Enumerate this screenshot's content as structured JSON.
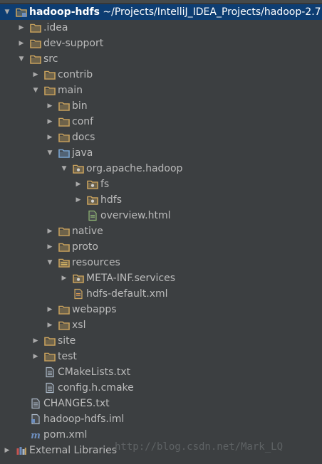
{
  "project_tree": {
    "root": {
      "name": "hadoop-hdfs",
      "path": "~/Projects/IntelliJ_IDEA_Projects/hadoop-2.7"
    },
    "items": [
      {
        "label": "hadoop-hdfs",
        "depth": 0,
        "arrow": "expanded",
        "icon": "module-folder-icon",
        "selected": true
      },
      {
        "label": ".idea",
        "depth": 1,
        "arrow": "collapsed",
        "icon": "folder-icon"
      },
      {
        "label": "dev-support",
        "depth": 1,
        "arrow": "collapsed",
        "icon": "folder-icon"
      },
      {
        "label": "src",
        "depth": 1,
        "arrow": "expanded",
        "icon": "folder-icon"
      },
      {
        "label": "contrib",
        "depth": 2,
        "arrow": "collapsed",
        "icon": "folder-icon"
      },
      {
        "label": "main",
        "depth": 2,
        "arrow": "expanded",
        "icon": "folder-icon"
      },
      {
        "label": "bin",
        "depth": 3,
        "arrow": "collapsed",
        "icon": "folder-icon"
      },
      {
        "label": "conf",
        "depth": 3,
        "arrow": "collapsed",
        "icon": "folder-icon"
      },
      {
        "label": "docs",
        "depth": 3,
        "arrow": "collapsed",
        "icon": "folder-icon"
      },
      {
        "label": "java",
        "depth": 3,
        "arrow": "expanded",
        "icon": "source-root-folder-icon"
      },
      {
        "label": "org.apache.hadoop",
        "depth": 4,
        "arrow": "expanded",
        "icon": "package-icon"
      },
      {
        "label": "fs",
        "depth": 5,
        "arrow": "collapsed",
        "icon": "package-icon"
      },
      {
        "label": "hdfs",
        "depth": 5,
        "arrow": "collapsed",
        "icon": "package-icon"
      },
      {
        "label": "overview.html",
        "depth": 5,
        "arrow": "none",
        "icon": "html-file-icon"
      },
      {
        "label": "native",
        "depth": 3,
        "arrow": "collapsed",
        "icon": "folder-icon"
      },
      {
        "label": "proto",
        "depth": 3,
        "arrow": "collapsed",
        "icon": "folder-icon"
      },
      {
        "label": "resources",
        "depth": 3,
        "arrow": "expanded",
        "icon": "resources-folder-icon"
      },
      {
        "label": "META-INF.services",
        "depth": 4,
        "arrow": "collapsed",
        "icon": "package-icon"
      },
      {
        "label": "hdfs-default.xml",
        "depth": 4,
        "arrow": "none",
        "icon": "xml-file-icon"
      },
      {
        "label": "webapps",
        "depth": 3,
        "arrow": "collapsed",
        "icon": "folder-icon"
      },
      {
        "label": "xsl",
        "depth": 3,
        "arrow": "collapsed",
        "icon": "folder-icon"
      },
      {
        "label": "site",
        "depth": 2,
        "arrow": "collapsed",
        "icon": "folder-icon"
      },
      {
        "label": "test",
        "depth": 2,
        "arrow": "collapsed",
        "icon": "folder-icon"
      },
      {
        "label": "CMakeLists.txt",
        "depth": 2,
        "arrow": "none",
        "icon": "text-file-icon"
      },
      {
        "label": "config.h.cmake",
        "depth": 2,
        "arrow": "none",
        "icon": "text-file-icon"
      },
      {
        "label": "CHANGES.txt",
        "depth": 1,
        "arrow": "none",
        "icon": "text-file-icon"
      },
      {
        "label": "hadoop-hdfs.iml",
        "depth": 1,
        "arrow": "none",
        "icon": "iml-file-icon"
      },
      {
        "label": "pom.xml",
        "depth": 1,
        "arrow": "none",
        "icon": "maven-file-icon"
      },
      {
        "label": "External Libraries",
        "depth": 0,
        "arrow": "collapsed",
        "icon": "libraries-icon"
      }
    ]
  },
  "watermark": "http://blog.csdn.net/Mark_LQ",
  "colors": {
    "background": "#3c3f41",
    "selection": "#0d3d72",
    "folder": "#c9a25d",
    "source_root": "#7ba7d4",
    "text": "#bbbbbb"
  },
  "glyphs": {
    "expanded": "▼",
    "collapsed": "▶",
    "maven": "m"
  }
}
